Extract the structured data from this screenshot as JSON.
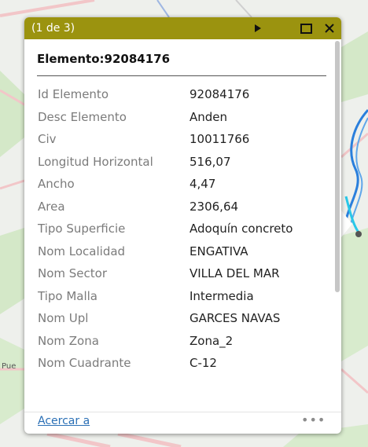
{
  "map": {
    "edge_label": "Pue",
    "colors": {
      "background": "#eef0ec",
      "roads": "#f6cfd0",
      "parks": "#cfe6c3",
      "river": "#0d7bd8"
    }
  },
  "popup": {
    "pager": "(1 de 3)",
    "colors": {
      "titlebar": "#9b930f",
      "link": "#2a6fb5"
    },
    "icons": {
      "next": "play-triangle",
      "maximize": "maximize-square",
      "close": "close-x",
      "more": "more-dots"
    },
    "title": "Elemento:92084176",
    "fields": [
      {
        "label": "Id Elemento",
        "value": "92084176"
      },
      {
        "label": "Desc Elemento",
        "value": "Anden"
      },
      {
        "label": "Civ",
        "value": "10011766"
      },
      {
        "label": "Longitud Horizontal",
        "value": "516,07"
      },
      {
        "label": "Ancho",
        "value": "4,47"
      },
      {
        "label": "Area",
        "value": "2306,64"
      },
      {
        "label": "Tipo Superficie",
        "value": "Adoquín concreto"
      },
      {
        "label": "Nom Localidad",
        "value": "ENGATIVA"
      },
      {
        "label": "Nom Sector",
        "value": "VILLA DEL MAR"
      },
      {
        "label": "Tipo Malla",
        "value": "Intermedia"
      },
      {
        "label": "Nom Upl",
        "value": "GARCES NAVAS"
      },
      {
        "label": "Nom Zona",
        "value": "Zona_2"
      },
      {
        "label": "Nom Cuadrante",
        "value": "C-12"
      }
    ],
    "zoom_link": "Acercar a",
    "more_label": "•••"
  }
}
